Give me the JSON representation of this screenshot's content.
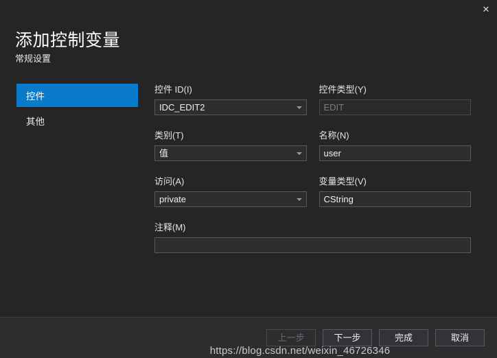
{
  "window": {
    "close_label": "✕",
    "close_icon": "close-icon"
  },
  "header": {
    "title": "添加控制变量",
    "subtitle": "常规设置"
  },
  "sidebar": {
    "items": [
      {
        "label": "控件",
        "selected": true
      },
      {
        "label": "其他",
        "selected": false
      }
    ]
  },
  "form": {
    "fields": {
      "control_id": {
        "label": "控件 ID(I)",
        "value": "IDC_EDIT2",
        "type": "combobox",
        "enabled": true
      },
      "control_type": {
        "label": "控件类型(Y)",
        "value": "EDIT",
        "type": "textbox",
        "enabled": false
      },
      "category": {
        "label": "类别(T)",
        "value": "值",
        "type": "combobox",
        "enabled": true
      },
      "name": {
        "label": "名称(N)",
        "value": "user",
        "type": "textbox",
        "enabled": true
      },
      "access": {
        "label": "访问(A)",
        "value": "private",
        "type": "combobox",
        "enabled": true
      },
      "variable_type": {
        "label": "变量类型(V)",
        "value": "CString",
        "type": "textbox",
        "enabled": true
      },
      "comment": {
        "label": "注释(M)",
        "value": "",
        "type": "textbox",
        "enabled": true
      }
    }
  },
  "footer": {
    "buttons": [
      {
        "label": "上一步",
        "enabled": false
      },
      {
        "label": "下一步",
        "enabled": true
      },
      {
        "label": "完成",
        "enabled": true
      },
      {
        "label": "取消",
        "enabled": true
      }
    ]
  },
  "watermark": {
    "text": "https://blog.csdn.net/weixin_46726346"
  },
  "colors": {
    "background": "#252526",
    "footer_background": "#2d2d30",
    "accent_blue": "#0a7bca",
    "control_background": "#2d2d30",
    "control_border": "#5a5a5e",
    "text": "#f0f0f0",
    "text_disabled": "#7e7e82"
  }
}
